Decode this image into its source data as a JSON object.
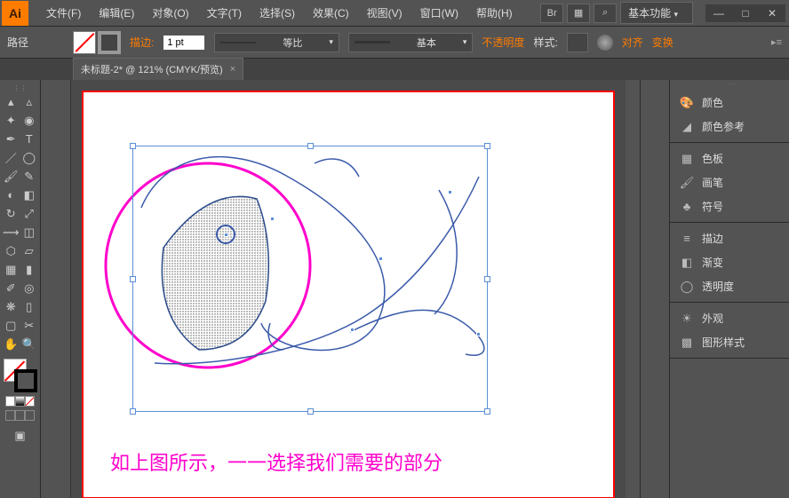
{
  "titlebar": {
    "logo": "Ai",
    "menu": [
      {
        "label": "文件(F)"
      },
      {
        "label": "编辑(E)"
      },
      {
        "label": "对象(O)"
      },
      {
        "label": "文字(T)"
      },
      {
        "label": "选择(S)"
      },
      {
        "label": "效果(C)"
      },
      {
        "label": "视图(V)"
      },
      {
        "label": "窗口(W)"
      },
      {
        "label": "帮助(H)"
      }
    ],
    "workspace": "基本功能",
    "window_btns": {
      "min": "—",
      "max": "□",
      "close": "✕"
    }
  },
  "controlbar": {
    "object_type": "路径",
    "stroke_label": "描边:",
    "stroke_value": "1 pt",
    "profile_label": "等比",
    "brush_label": "基本",
    "opacity_label": "不透明度",
    "style_label": "样式:",
    "align_label": "对齐",
    "transform_label": "变换"
  },
  "tab": {
    "title": "未标题-2* @ 121% (CMYK/预览)",
    "close": "×"
  },
  "panels": {
    "group1": [
      {
        "icon": "palette",
        "label": "颜色"
      },
      {
        "icon": "guide",
        "label": "颜色参考"
      }
    ],
    "group2": [
      {
        "icon": "grid",
        "label": "色板"
      },
      {
        "icon": "brush",
        "label": "画笔"
      },
      {
        "icon": "symbol",
        "label": "符号"
      }
    ],
    "group3": [
      {
        "icon": "lines",
        "label": "描边"
      },
      {
        "icon": "gradient",
        "label": "渐变"
      },
      {
        "icon": "circle",
        "label": "透明度"
      }
    ],
    "group4": [
      {
        "icon": "sun",
        "label": "外观"
      },
      {
        "icon": "styles",
        "label": "图形样式"
      }
    ]
  },
  "canvas": {
    "caption": "如上图所示，一一选择我们需要的部分"
  },
  "tools": {
    "names": [
      "selection",
      "direct-sel",
      "wand",
      "lasso",
      "pen",
      "type",
      "line",
      "ellipse",
      "brush",
      "pencil",
      "blob",
      "eraser",
      "rotate",
      "scale",
      "width",
      "free",
      "shape-builder",
      "perspective",
      "mesh",
      "gradient",
      "eyedrop",
      "blend",
      "symbol-spray",
      "graph",
      "artboard",
      "slice",
      "hand",
      "zoom"
    ]
  }
}
